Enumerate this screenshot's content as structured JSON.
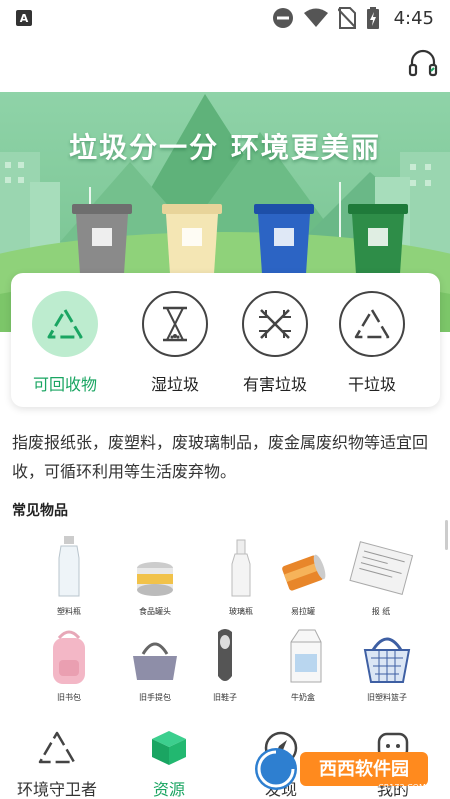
{
  "status_bar": {
    "app_badge": "A",
    "time": "4:45"
  },
  "banner": {
    "title": "垃圾分一分 环境更美丽"
  },
  "categories": [
    {
      "label": "可回收物",
      "icon": "recycle-icon",
      "active": true
    },
    {
      "label": "湿垃圾",
      "icon": "hourglass-icon",
      "active": false
    },
    {
      "label": "有害垃圾",
      "icon": "hazard-cross-icon",
      "active": false
    },
    {
      "label": "干垃圾",
      "icon": "recycle-outline-icon",
      "active": false
    }
  ],
  "description": "指废报纸张，废塑料，废玻璃制品，废金属废织物等适宜回收，可循环利用等生活废弃物。",
  "section_title": "常见物品",
  "items": [
    {
      "label": "塑料瓶"
    },
    {
      "label": "食品罐头"
    },
    {
      "label": "玻璃瓶"
    },
    {
      "label": "易拉罐"
    },
    {
      "label": "报 纸"
    },
    {
      "label": "旧书包"
    },
    {
      "label": "旧手提包"
    },
    {
      "label": "旧鞋子"
    },
    {
      "label": "牛奶盒"
    },
    {
      "label": "旧塑料篮子"
    }
  ],
  "bottom_nav": [
    {
      "label": "环境守卫者",
      "icon": "recycle-nav-icon",
      "active": false
    },
    {
      "label": "资源",
      "icon": "cube-icon",
      "active": true
    },
    {
      "label": "发现",
      "icon": "compass-icon",
      "active": false
    },
    {
      "label": "我的",
      "icon": "chat-icon",
      "active": false
    }
  ],
  "watermark": {
    "text": "西西软件园",
    "sub": "CR173.COM"
  },
  "colors": {
    "accent": "#1aa562",
    "active_circle": "#bdeccf",
    "banner_green": "#7fc898"
  }
}
